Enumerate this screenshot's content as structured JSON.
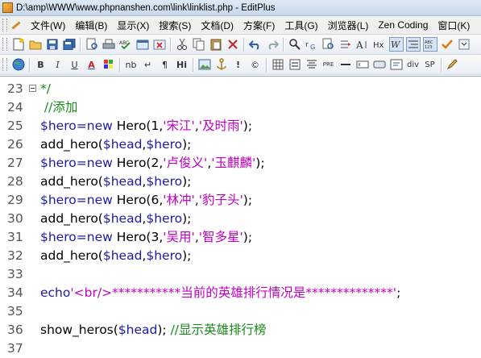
{
  "window": {
    "title": "D:\\amp\\WWW\\www.phpnanshen.com\\link\\linklist.php - EditPlus"
  },
  "menu": [
    "文件(W)",
    "编辑(B)",
    "显示(X)",
    "搜索(S)",
    "文档(D)",
    "方案(F)",
    "工具(G)",
    "浏览器(L)",
    "Zen Coding",
    "窗口(K)"
  ],
  "toolbar2_labels": {
    "bold": "B",
    "italic": "I",
    "underline": "U",
    "font": "A",
    "nbsp": "nb",
    "br": "↵",
    "para": "¶",
    "hi": "Hi",
    "pre": "PRE",
    "div": "div",
    "sp": "SP"
  },
  "editor": {
    "lines": [
      {
        "num": "23",
        "fold": true,
        "tokens": [
          {
            "t": "*/",
            "c": "c-cm"
          }
        ]
      },
      {
        "num": "24",
        "fold": false,
        "tokens": [
          {
            "t": " //添加",
            "c": "c-cm"
          }
        ]
      },
      {
        "num": "25",
        "fold": false,
        "tokens": [
          {
            "t": "$hero",
            "c": "c-var"
          },
          {
            "t": "=",
            "c": "c-op"
          },
          {
            "t": "new",
            "c": "c-kw"
          },
          {
            "t": " Hero(1,",
            "c": "c-plain"
          },
          {
            "t": "'宋江'",
            "c": "c-str"
          },
          {
            "t": ",",
            "c": "c-plain"
          },
          {
            "t": "'及时雨'",
            "c": "c-str"
          },
          {
            "t": ");",
            "c": "c-plain"
          }
        ]
      },
      {
        "num": "26",
        "fold": false,
        "tokens": [
          {
            "t": "add_hero(",
            "c": "c-plain"
          },
          {
            "t": "$head",
            "c": "c-var"
          },
          {
            "t": ",",
            "c": "c-plain"
          },
          {
            "t": "$hero",
            "c": "c-var"
          },
          {
            "t": ");",
            "c": "c-plain"
          }
        ]
      },
      {
        "num": "27",
        "fold": false,
        "tokens": [
          {
            "t": "$hero",
            "c": "c-var"
          },
          {
            "t": "=",
            "c": "c-op"
          },
          {
            "t": "new",
            "c": "c-kw"
          },
          {
            "t": " Hero(2,",
            "c": "c-plain"
          },
          {
            "t": "'卢俊义'",
            "c": "c-str"
          },
          {
            "t": ",",
            "c": "c-plain"
          },
          {
            "t": "'玉麒麟'",
            "c": "c-str"
          },
          {
            "t": ");",
            "c": "c-plain"
          }
        ]
      },
      {
        "num": "28",
        "fold": false,
        "tokens": [
          {
            "t": "add_hero(",
            "c": "c-plain"
          },
          {
            "t": "$head",
            "c": "c-var"
          },
          {
            "t": ",",
            "c": "c-plain"
          },
          {
            "t": "$hero",
            "c": "c-var"
          },
          {
            "t": ");",
            "c": "c-plain"
          }
        ]
      },
      {
        "num": "29",
        "fold": false,
        "tokens": [
          {
            "t": "$hero",
            "c": "c-var"
          },
          {
            "t": "=",
            "c": "c-op"
          },
          {
            "t": "new",
            "c": "c-kw"
          },
          {
            "t": " Hero(6,",
            "c": "c-plain"
          },
          {
            "t": "'林冲'",
            "c": "c-str"
          },
          {
            "t": ",",
            "c": "c-plain"
          },
          {
            "t": "'豹子头'",
            "c": "c-str"
          },
          {
            "t": ");",
            "c": "c-plain"
          }
        ]
      },
      {
        "num": "30",
        "fold": false,
        "tokens": [
          {
            "t": "add_hero(",
            "c": "c-plain"
          },
          {
            "t": "$head",
            "c": "c-var"
          },
          {
            "t": ",",
            "c": "c-plain"
          },
          {
            "t": "$hero",
            "c": "c-var"
          },
          {
            "t": ");",
            "c": "c-plain"
          }
        ]
      },
      {
        "num": "31",
        "fold": false,
        "tokens": [
          {
            "t": "$hero",
            "c": "c-var"
          },
          {
            "t": "=",
            "c": "c-op"
          },
          {
            "t": "new",
            "c": "c-kw"
          },
          {
            "t": " Hero(3,",
            "c": "c-plain"
          },
          {
            "t": "'吴用'",
            "c": "c-str"
          },
          {
            "t": ",",
            "c": "c-plain"
          },
          {
            "t": "'智多星'",
            "c": "c-str"
          },
          {
            "t": ");",
            "c": "c-plain"
          }
        ]
      },
      {
        "num": "32",
        "fold": false,
        "tokens": [
          {
            "t": "add_hero(",
            "c": "c-plain"
          },
          {
            "t": "$head",
            "c": "c-var"
          },
          {
            "t": ",",
            "c": "c-plain"
          },
          {
            "t": "$hero",
            "c": "c-var"
          },
          {
            "t": ");",
            "c": "c-plain"
          }
        ]
      },
      {
        "num": "33",
        "fold": false,
        "tokens": []
      },
      {
        "num": "34",
        "fold": false,
        "tokens": [
          {
            "t": "echo",
            "c": "c-kw"
          },
          {
            "t": "'<br/>***********当前的英雄排行情况是**************'",
            "c": "c-str"
          },
          {
            "t": ";",
            "c": "c-plain"
          }
        ]
      },
      {
        "num": "35",
        "fold": false,
        "tokens": []
      },
      {
        "num": "36",
        "fold": false,
        "tokens": [
          {
            "t": "show_heros(",
            "c": "c-plain"
          },
          {
            "t": "$head",
            "c": "c-var"
          },
          {
            "t": "); ",
            "c": "c-plain"
          },
          {
            "t": "//显示英雄排行榜",
            "c": "c-cm"
          }
        ]
      },
      {
        "num": "37",
        "fold": false,
        "tokens": []
      }
    ]
  }
}
